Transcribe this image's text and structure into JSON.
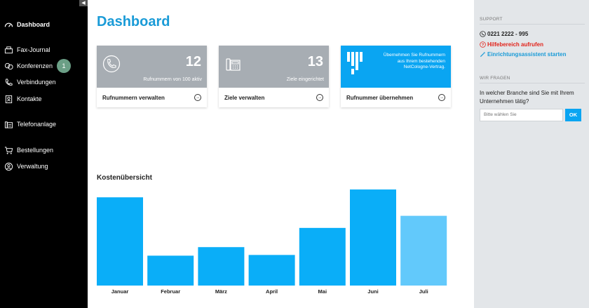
{
  "sidebar": {
    "items": [
      {
        "label": "Dashboard",
        "icon": "dashboard-icon"
      },
      {
        "label": "Fax-Journal",
        "icon": "fax-icon"
      },
      {
        "label": "Konferenzen",
        "icon": "conference-icon",
        "badge": "1"
      },
      {
        "label": "Verbindungen",
        "icon": "phone-icon"
      },
      {
        "label": "Kontakte",
        "icon": "contacts-icon"
      },
      {
        "label": "Telefonanlage",
        "icon": "phone-system-icon"
      },
      {
        "label": "Bestellungen",
        "icon": "cart-icon"
      },
      {
        "label": "Verwaltung",
        "icon": "user-icon"
      }
    ]
  },
  "main": {
    "title": "Dashboard",
    "cards": [
      {
        "number": "12",
        "subtitle": "Rufnummern von 100 aktiv",
        "action": "Rufnummern verwalten",
        "icon": "phone-icon"
      },
      {
        "number": "13",
        "subtitle": "Ziele eingerichtet",
        "action": "Ziele verwalten",
        "icon": "desk-phone-icon"
      },
      {
        "text": "Übernehmen Sie Rufnummern aus Ihrem bestehenden NetCologne-Vertrag.",
        "action": "Rufnummer übernehmen",
        "icon": "netcologne-logo"
      }
    ],
    "section_title": "Kostenübersicht"
  },
  "chart_data": {
    "type": "bar",
    "categories": [
      "Januar",
      "Februar",
      "März",
      "April",
      "Mai",
      "Juni",
      "Juli"
    ],
    "values": [
      124,
      42,
      54,
      43,
      81,
      135,
      98
    ],
    "ylim": [
      0,
      140
    ],
    "colors": [
      "#0aaef8",
      "#0aaef8",
      "#0aaef8",
      "#0aaef8",
      "#0aaef8",
      "#0aaef8",
      "#62c9fb"
    ]
  },
  "right": {
    "support_head": "SUPPORT",
    "phone": "0221 2222 - 995",
    "help_link": "Hilfebereich aufrufen",
    "wizard_link": "Einrichtungsassistent starten",
    "questions_head": "WIR FRAGEN",
    "question": "In welcher Branche sind Sie mit Ihrem Unternehmen tätig?",
    "select_placeholder": "Bitte wählen Sie",
    "ok_label": "OK"
  },
  "colors": {
    "accent": "#0aa5f2",
    "title": "#1a9bd7",
    "help": "#e2231a",
    "badge": "#6b9f86"
  }
}
